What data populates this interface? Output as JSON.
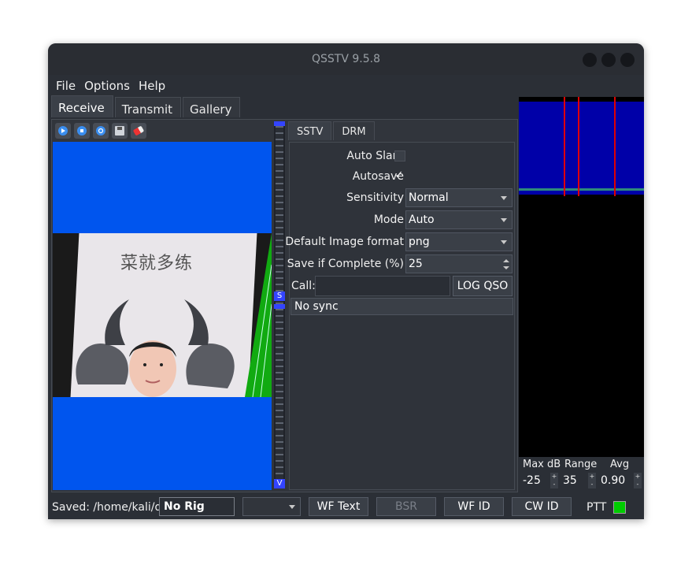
{
  "window": {
    "title": "QSSTV 9.5.8"
  },
  "menu": {
    "file": "File",
    "options": "Options",
    "help": "Help"
  },
  "tabs": {
    "receive": "Receive",
    "transmit": "Transmit",
    "gallery": "Gallery"
  },
  "toolbar_icons": [
    "start-icon",
    "stop-icon",
    "refresh-icon",
    "save-icon",
    "erase-icon"
  ],
  "image": {
    "caption": "菜就多练"
  },
  "vbar": {
    "top_marker": "S",
    "bottom_marker": "V"
  },
  "subtabs": {
    "sstv": "SSTV",
    "drm": "DRM"
  },
  "form": {
    "auto_slant_label": "Auto Slant",
    "auto_slant_checked": false,
    "autosave_label": "Autosave",
    "autosave_mark": "✓",
    "sensitivity_label": "Sensitivity",
    "sensitivity_value": "Normal",
    "mode_label": "Mode",
    "mode_value": "Auto",
    "format_label": "Default Image format",
    "format_value": "png",
    "save_complete_label": "Save if Complete (%)",
    "save_complete_value": "25",
    "call_label": "Call:",
    "call_value": "",
    "log_qso": "LOG QSO",
    "sync_status": "No sync"
  },
  "stats": {
    "max_db_label": "Max dB",
    "max_db_value": "-25",
    "range_label": "Range",
    "range_value": "35",
    "avg_label": "Avg",
    "avg_value": "0.90",
    "spin_up": "+",
    "spin_down": "-"
  },
  "status": {
    "saved": "Saved: /home/kali/q",
    "rig": "No Rig",
    "wf_text": "WF Text",
    "bsr": "BSR",
    "wf_id": "WF ID",
    "cw_id": "CW ID",
    "ptt": "PTT"
  },
  "colors": {
    "accent": "#0055ee",
    "spectrum": "#0000a8",
    "marker": "#e00000",
    "ptt": "#00cc00"
  }
}
